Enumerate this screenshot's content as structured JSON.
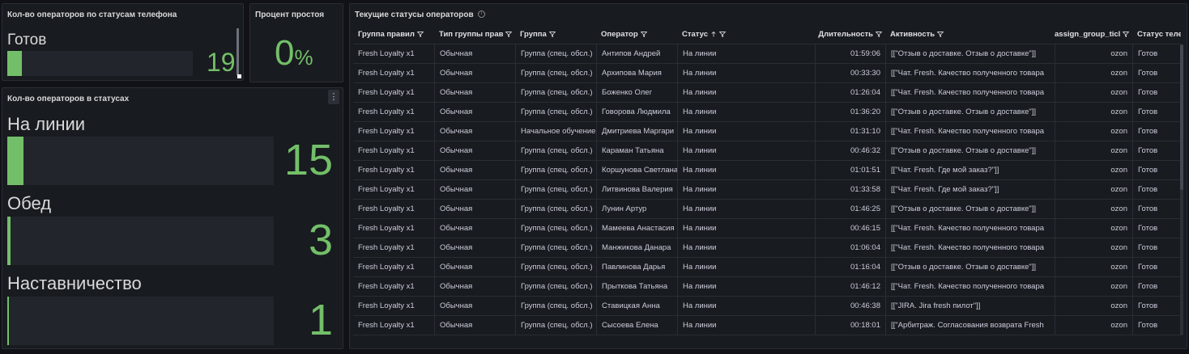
{
  "colors": {
    "accent": "#73bf69",
    "bg": "#111217",
    "panel": "#181b1f"
  },
  "panel_phone_status": {
    "title": "Кол-во операторов по статусам телефона",
    "label": "Готов",
    "value": "19",
    "fill_fraction": 0.08
  },
  "panel_idle": {
    "title": "Процент простоя",
    "value": "0",
    "unit": "%"
  },
  "panel_statuses": {
    "title": "Кол-во операторов в статусах",
    "groups": [
      {
        "label": "На линии",
        "value": "15",
        "fill_fraction": 0.06
      },
      {
        "label": "Обед",
        "value": "3",
        "fill_fraction": 0.012
      },
      {
        "label": "Наставничество",
        "value": "1",
        "fill_fraction": 0.004
      }
    ]
  },
  "panel_table": {
    "title": "Текущие статусы операторов",
    "columns": [
      {
        "label": "Группа правил",
        "filter": true
      },
      {
        "label": "Тип группы прав",
        "filter": true
      },
      {
        "label": "Группа",
        "filter": true
      },
      {
        "label": "Оператор",
        "filter": true
      },
      {
        "label": "Статус",
        "filter": true,
        "sort": "asc"
      },
      {
        "label": "Длительность",
        "filter": true
      },
      {
        "label": "Активность",
        "filter": true
      },
      {
        "label": "assign_group_ticl",
        "filter": true
      },
      {
        "label": "Статус теле",
        "filter": false
      }
    ],
    "rows": [
      [
        "Fresh Loyalty x1",
        "Обычная",
        "Группа (спец. обсл.)",
        "Антипов Андрей",
        "На линии",
        "01:59:06",
        "[[\"Отзыв о доставке. Отзыв о доставке\"]]",
        "ozon",
        "Готов"
      ],
      [
        "Fresh Loyalty x1",
        "Обычная",
        "Группа (спец. обсл.)",
        "Архипова Мария",
        "На линии",
        "00:33:30",
        "[[\"Чат. Fresh. Качество полученного товара",
        "ozon",
        "Готов"
      ],
      [
        "Fresh Loyalty x1",
        "Обычная",
        "Группа (спец. обсл.)",
        "Боженко Олег",
        "На линии",
        "01:26:04",
        "[[\"Чат. Fresh. Качество полученного товара",
        "ozon",
        "Готов"
      ],
      [
        "Fresh Loyalty x1",
        "Обычная",
        "Группа (спец. обсл.)",
        "Говорова Людмила",
        "На линии",
        "01:36:20",
        "[[\"Отзыв о доставке. Отзыв о доставке\"]]",
        "ozon",
        "Готов"
      ],
      [
        "Fresh Loyalty x1",
        "Обычная",
        "Начальное обучение",
        "Дмитриева Маргари",
        "На линии",
        "01:31:10",
        "[[\"Чат. Fresh. Качество полученного товара",
        "ozon",
        "Готов"
      ],
      [
        "Fresh Loyalty x1",
        "Обычная",
        "Группа (спец. обсл.)",
        "Караман Татьяна",
        "На линии",
        "00:46:32",
        "[[\"Отзыв о доставке. Отзыв о доставке\"]]",
        "ozon",
        "Готов"
      ],
      [
        "Fresh Loyalty x1",
        "Обычная",
        "Группа (спец. обсл.)",
        "Коршунова Светлана",
        "На линии",
        "01:01:51",
        "[[\"Чат. Fresh. Где мой заказ?\"]]",
        "ozon",
        "Готов"
      ],
      [
        "Fresh Loyalty x1",
        "Обычная",
        "Группа (спец. обсл.)",
        "Литвинова Валерия",
        "На линии",
        "01:33:58",
        "[[\"Чат. Fresh. Где мой заказ?\"]]",
        "ozon",
        "Готов"
      ],
      [
        "Fresh Loyalty x1",
        "Обычная",
        "Группа (спец. обсл.)",
        "Лунин Артур",
        "На линии",
        "01:46:25",
        "[[\"Отзыв о доставке. Отзыв о доставке\"]]",
        "ozon",
        "Готов"
      ],
      [
        "Fresh Loyalty x1",
        "Обычная",
        "Группа (спец. обсл.)",
        "Мамеева Анастасия",
        "На линии",
        "00:46:15",
        "[[\"Чат. Fresh. Качество полученного товара",
        "ozon",
        "Готов"
      ],
      [
        "Fresh Loyalty x1",
        "Обычная",
        "Группа (спец. обсл.)",
        "Манжикова Данара",
        "На линии",
        "01:06:04",
        "[[\"Чат. Fresh. Качество полученного товара",
        "ozon",
        "Готов"
      ],
      [
        "Fresh Loyalty x1",
        "Обычная",
        "Группа (спец. обсл.)",
        "Павлинова Дарья",
        "На линии",
        "01:16:04",
        "[[\"Отзыв о доставке. Отзыв о доставке\"]]",
        "ozon",
        "Готов"
      ],
      [
        "Fresh Loyalty x1",
        "Обычная",
        "Группа (спец. обсл.)",
        "Прыткова Татьяна",
        "На линии",
        "01:46:12",
        "[[\"Чат. Fresh. Качество полученного товара",
        "ozon",
        "Готов"
      ],
      [
        "Fresh Loyalty x1",
        "Обычная",
        "Группа (спец. обсл.)",
        "Ставицкая Анна",
        "На линии",
        "00:46:38",
        "[[\"JIRA. Jira fresh пилот\"]]",
        "ozon",
        "Готов"
      ],
      [
        "Fresh Loyalty x1",
        "Обычная",
        "Группа (спец. обсл.)",
        "Сысоева Елена",
        "На линии",
        "00:18:01",
        "[[\"Арбитраж. Согласования возврата Fresh",
        "ozon",
        "Готов"
      ]
    ]
  }
}
